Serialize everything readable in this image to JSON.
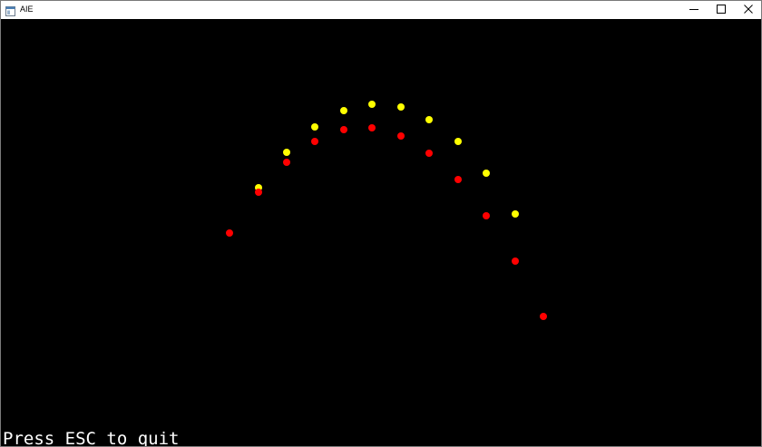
{
  "window": {
    "title": "AIE",
    "icon": "app-window-icon",
    "controls": [
      "minimize-icon",
      "maximize-icon",
      "close-icon"
    ]
  },
  "scene": {
    "background": "#000000",
    "hint_text": "Press ESC to quit",
    "yellow_color": "#ffff00",
    "red_color": "#ff0000"
  }
}
